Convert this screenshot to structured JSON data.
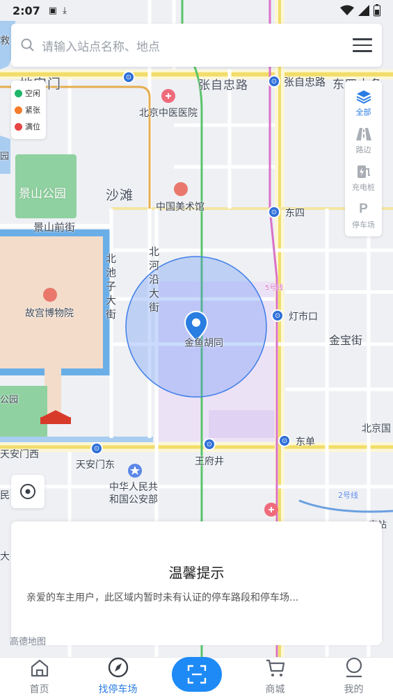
{
  "status_bar": {
    "time": "2:07"
  },
  "search": {
    "placeholder": "请输入站点名称、地点"
  },
  "legend": [
    {
      "label": "空闲",
      "color": "#1fb66a"
    },
    {
      "label": "紧张",
      "color": "#f57c2b"
    },
    {
      "label": "满位",
      "color": "#e84545"
    }
  ],
  "filters": [
    {
      "label": "全部",
      "icon": "layers-icon",
      "active": true
    },
    {
      "label": "路边",
      "icon": "road-icon",
      "active": false
    },
    {
      "label": "充电桩",
      "icon": "charging-icon",
      "active": false
    },
    {
      "label": "停车场",
      "icon": "parking-icon",
      "active": false
    }
  ],
  "map": {
    "labels": {
      "dianmen": "地安门",
      "zhangzizhong_road": "张自忠路",
      "zhangzizhong_station": "张自忠路",
      "dongsi_shitiao": "东四十条",
      "tcm_hospital": "北京中医医院",
      "jingshan_park": "景山公园",
      "shatan": "沙滩",
      "art_museum": "中国美术馆",
      "dongsi": "东四",
      "jingshan_front": "景山前街",
      "beichizi": "北池子大街",
      "beiheyan": "北河沿大街",
      "line5": "5号线",
      "palace_museum": "故宫博物院",
      "dengshikou": "灯市口",
      "jinyu_hutong": "金鱼胡同",
      "jinbao": "金宝街",
      "beijing_station": "北京国",
      "tiananmen_west": "天安门西",
      "tiananmen_east": "天安门东",
      "wangfujing": "王府井",
      "dongdan": "东单",
      "public_security": "中华人民共和国公安部",
      "line2": "2号线",
      "jiu": "救",
      "gong": "园",
      "gong2": "公园",
      "min": "民",
      "da": "大",
      "jing_zhan": "京站"
    }
  },
  "tip": {
    "title": "温馨提示",
    "message": "亲爱的车主用户，此区域内暂时未有认证的停车路段和停车场..."
  },
  "watermark": "高德地图",
  "tabs": [
    {
      "label": "首页",
      "icon": "home-icon",
      "active": false
    },
    {
      "label": "找停车场",
      "icon": "compass-icon",
      "active": true
    },
    {
      "label": "",
      "icon": "scan-icon",
      "active": false
    },
    {
      "label": "商城",
      "icon": "cart-icon",
      "active": false
    },
    {
      "label": "我的",
      "icon": "user-icon",
      "active": false
    }
  ],
  "colors": {
    "accent": "#2a7de1",
    "scan": "#1e8af5"
  }
}
